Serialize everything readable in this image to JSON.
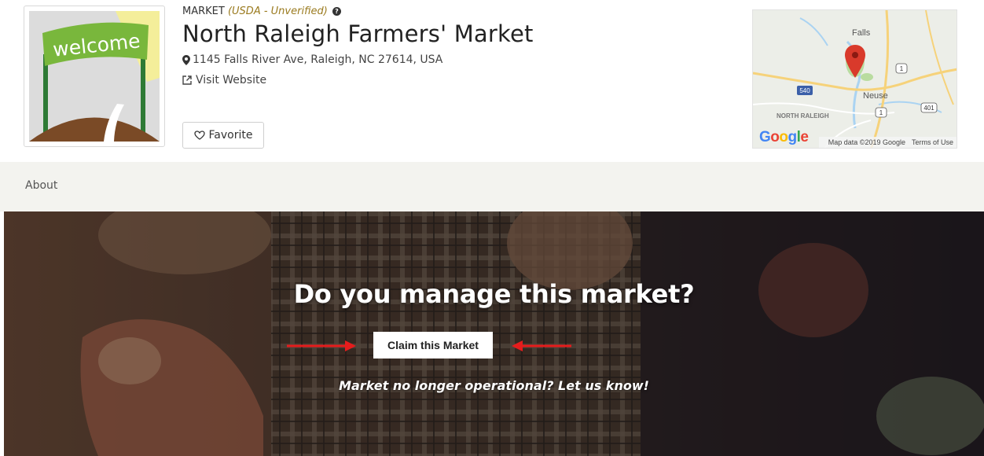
{
  "market": {
    "type_label": "MARKET",
    "status_label": "(USDA - Unverified)",
    "name": "North Raleigh Farmers' Market",
    "address": "1145 Falls River Ave, Raleigh, NC 27614, USA",
    "website_label": "Visit Website",
    "logo_text": "welcome"
  },
  "actions": {
    "favorite_label": "Favorite"
  },
  "map": {
    "labels": {
      "falls": "Falls",
      "neuse": "Neuse",
      "north_raleigh": "NORTH RALEIGH",
      "route_540": "540",
      "route_1a": "1",
      "route_1b": "1",
      "route_401": "401"
    },
    "google_logo": "Google",
    "attribution": "Map data ©2019 Google",
    "terms": "Terms of Use"
  },
  "nav": {
    "about_label": "About"
  },
  "hero": {
    "title": "Do you manage this market?",
    "claim_label": "Claim this Market",
    "report_link": "Market no longer operational? Let us know!"
  },
  "colors": {
    "unverified": "#9a7a1e",
    "map_pin": "#d93a2b",
    "annotation_arrow": "#e51c1c",
    "nav_bg": "#f3f3ef"
  }
}
